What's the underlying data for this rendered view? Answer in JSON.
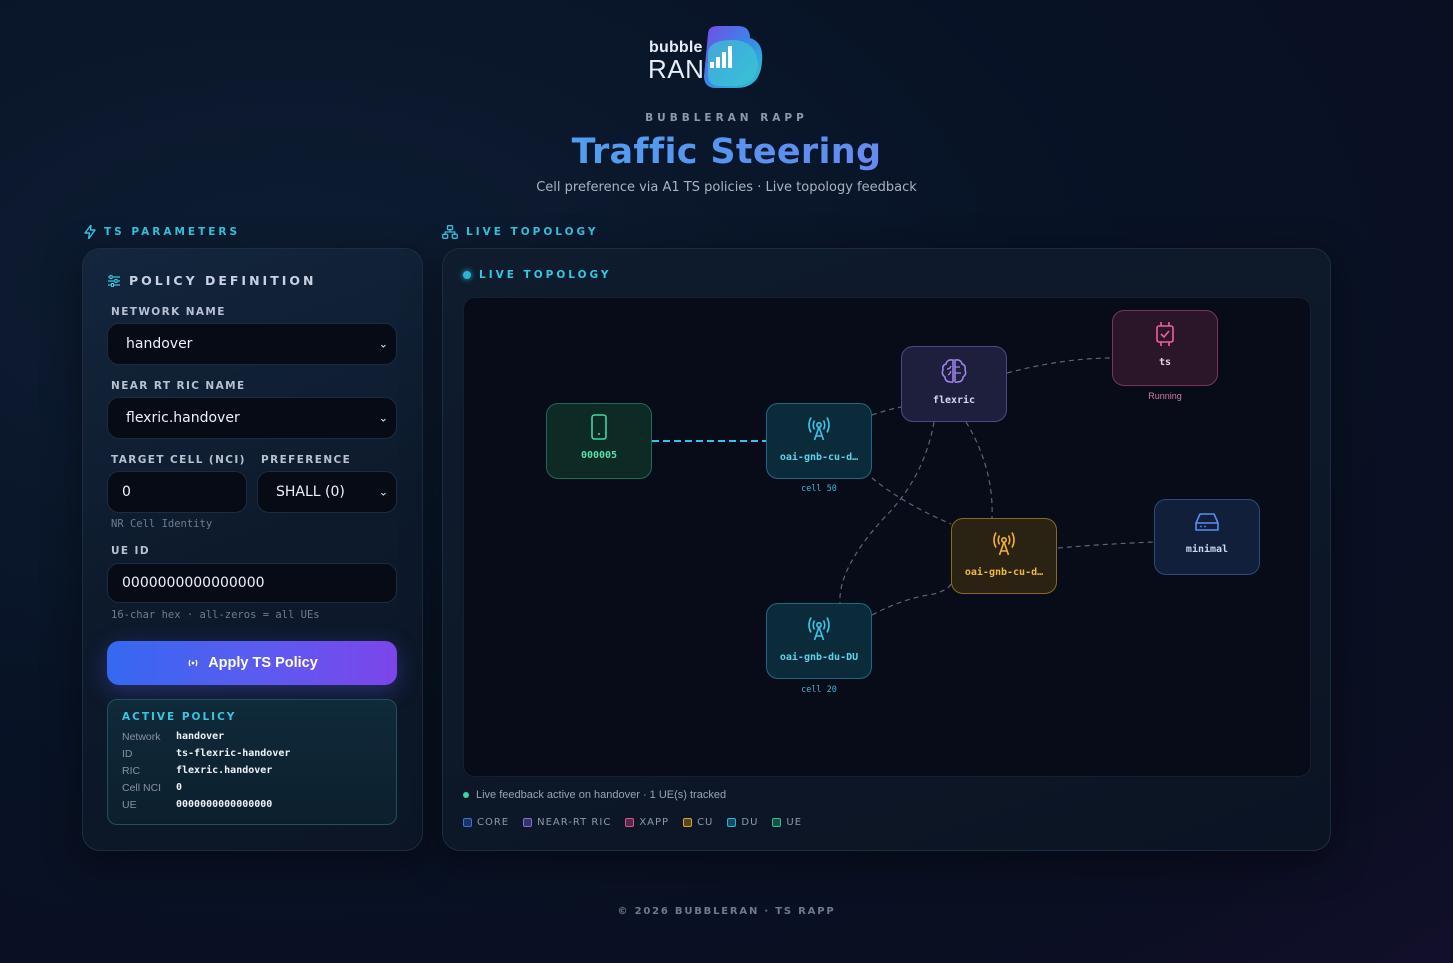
{
  "header": {
    "logo_word1": "bubble",
    "logo_word2": "RAN",
    "eyebrow": "BUBBLERAN RAPP",
    "title": "Traffic Steering",
    "subtitle": "Cell preference via A1 TS policies · Live topology feedback"
  },
  "left_section_label": "TS PARAMETERS",
  "right_section_label": "LIVE TOPOLOGY",
  "policy": {
    "heading": "POLICY DEFINITION",
    "network_name_label": "NETWORK NAME",
    "network_name_value": "handover",
    "ric_name_label": "NEAR RT RIC NAME",
    "ric_name_value": "flexric.handover",
    "target_cell_label": "TARGET CELL (NCI)",
    "target_cell_value": "0",
    "target_cell_hint": "NR Cell Identity",
    "preference_label": "PREFERENCE",
    "preference_value": "SHALL (0)",
    "ue_id_label": "UE ID",
    "ue_id_value": "0000000000000000",
    "ue_id_hint": "16-char hex · all-zeros = all UEs",
    "apply_button": "Apply TS Policy"
  },
  "active_policy": {
    "title": "ACTIVE POLICY",
    "rows": [
      {
        "key": "Network",
        "value": "handover"
      },
      {
        "key": "ID",
        "value": "ts-flexric-handover"
      },
      {
        "key": "RIC",
        "value": "flexric.handover"
      },
      {
        "key": "Cell NCI",
        "value": "0"
      },
      {
        "key": "UE",
        "value": "0000000000000000"
      }
    ]
  },
  "topology": {
    "heading": "LIVE TOPOLOGY",
    "nodes": {
      "ue": {
        "label": "000005"
      },
      "cudu": {
        "label": "oai-gnb-cu-d…",
        "sub": "cell 50"
      },
      "ric": {
        "label": "flexric"
      },
      "xapp": {
        "label": "ts",
        "sub": "Running"
      },
      "cu": {
        "label": "oai-gnb-cu-d…"
      },
      "core": {
        "label": "minimal"
      },
      "du": {
        "label": "oai-gnb-du-DU",
        "sub": "cell 20"
      }
    },
    "feedback": "Live feedback active on handover · 1 UE(s) tracked",
    "legend": [
      {
        "label": "CORE",
        "color": "#3f6fd8"
      },
      {
        "label": "NEAR-RT RIC",
        "color": "#8a6ae0"
      },
      {
        "label": "XAPP",
        "color": "#e0508e"
      },
      {
        "label": "CU",
        "color": "#e3a52a"
      },
      {
        "label": "DU",
        "color": "#2bb4d6"
      },
      {
        "label": "UE",
        "color": "#2fc48a"
      }
    ]
  },
  "footer": "© 2026 BUBBLERAN · TS RAPP"
}
